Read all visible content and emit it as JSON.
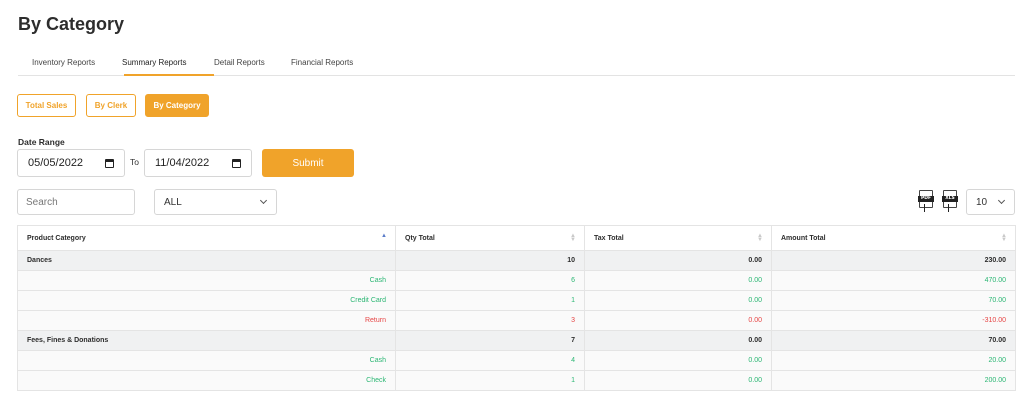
{
  "page": {
    "title": "By Category"
  },
  "tabs": [
    {
      "label": "Inventory Reports"
    },
    {
      "label": "Summary Reports"
    },
    {
      "label": "Detail Reports"
    },
    {
      "label": "Financial Reports"
    }
  ],
  "active_tab": "Summary Reports",
  "subtabs": [
    {
      "label": "Total Sales"
    },
    {
      "label": "By Clerk"
    },
    {
      "label": "By Category"
    }
  ],
  "active_subtab": "By Category",
  "filters": {
    "date_range_label": "Date Range",
    "start_date": "05/05/2022",
    "to_label": "To",
    "end_date": "11/04/2022",
    "submit_label": "Submit"
  },
  "toolbar": {
    "search_placeholder": "Search",
    "category_select": "ALL",
    "export_pdf": "PDF",
    "export_xls": "XLS",
    "page_size": "10"
  },
  "colors": {
    "accent": "#f0a32a",
    "positive": "#2bb673",
    "negative": "#e64545"
  },
  "table": {
    "columns": [
      "Product Category",
      "Qty Total",
      "Tax Total",
      "Amount Total"
    ],
    "sorted_column": "Product Category",
    "rows": [
      {
        "type": "group",
        "label": "Dances",
        "qty": "10",
        "tax": "0.00",
        "amount": "230.00"
      },
      {
        "type": "detail",
        "status": "positive",
        "label": "Cash",
        "qty": "6",
        "tax": "0.00",
        "amount": "470.00"
      },
      {
        "type": "detail",
        "status": "positive",
        "label": "Credit Card",
        "qty": "1",
        "tax": "0.00",
        "amount": "70.00"
      },
      {
        "type": "detail",
        "status": "negative",
        "label": "Return",
        "qty": "3",
        "tax": "0.00",
        "amount": "-310.00"
      },
      {
        "type": "group",
        "label": "Fees, Fines & Donations",
        "qty": "7",
        "tax": "0.00",
        "amount": "70.00"
      },
      {
        "type": "detail",
        "status": "positive",
        "label": "Cash",
        "qty": "4",
        "tax": "0.00",
        "amount": "20.00"
      },
      {
        "type": "detail",
        "status": "positive",
        "label": "Check",
        "qty": "1",
        "tax": "0.00",
        "amount": "200.00"
      }
    ]
  }
}
